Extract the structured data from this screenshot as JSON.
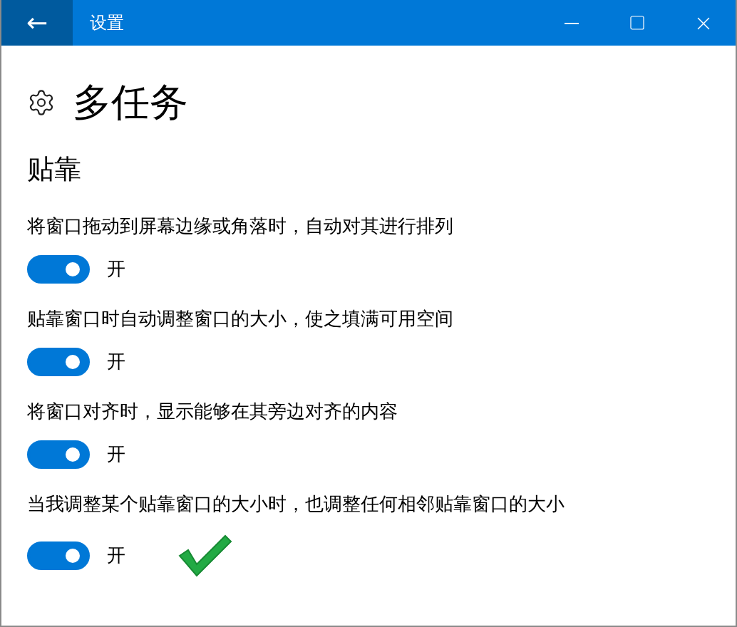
{
  "window": {
    "title": "设置",
    "back": "←"
  },
  "page": {
    "title": "多任务"
  },
  "section": {
    "title": "贴靠"
  },
  "settings": [
    {
      "label": "将窗口拖动到屏幕边缘或角落时，自动对其进行排列",
      "on": true,
      "state_text": "开"
    },
    {
      "label": "贴靠窗口时自动调整窗口的大小，使之填满可用空间",
      "on": true,
      "state_text": "开"
    },
    {
      "label": "将窗口对齐时，显示能够在其旁边对齐的内容",
      "on": true,
      "state_text": "开"
    },
    {
      "label": "当我调整某个贴靠窗口的大小时，也调整任何相邻贴靠窗口的大小",
      "on": true,
      "state_text": "开"
    }
  ]
}
